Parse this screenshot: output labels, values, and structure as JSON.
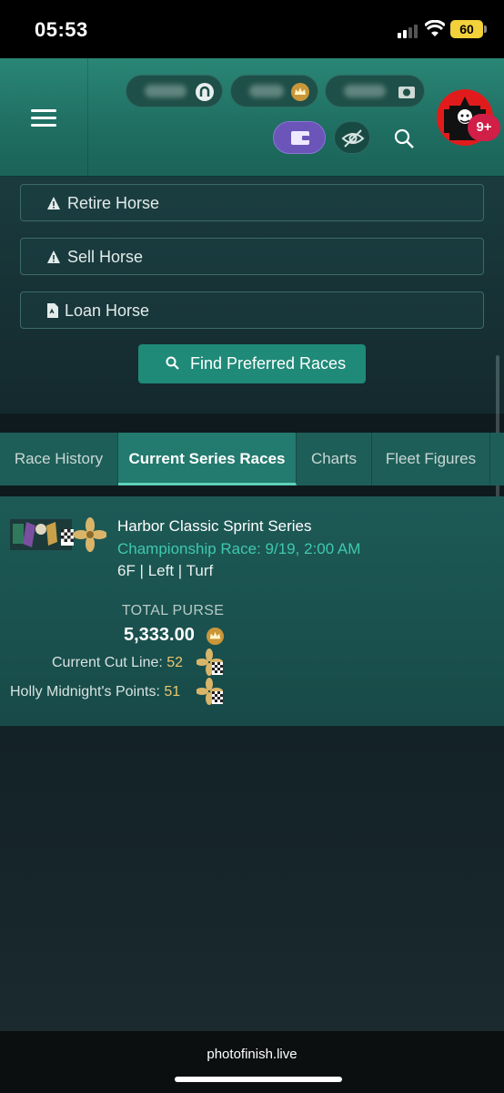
{
  "status_bar": {
    "time": "05:53",
    "battery": "60"
  },
  "header": {
    "menu_icon": "hamburger-icon",
    "currency_pills": [
      {
        "icon": "horseshoe-icon"
      },
      {
        "icon": "crown-coin-icon"
      },
      {
        "icon": "camera-icon"
      }
    ],
    "wallet_icon": "wallet-icon",
    "visibility_icon": "eye-off-icon",
    "search_icon": "search-icon",
    "notification_badge": "9+",
    "colors": {
      "header_bg": "#2a8676",
      "wallet_bg": "#6b55b8",
      "badge_bg": "#d11f47"
    }
  },
  "actions": {
    "retire": "Retire Horse",
    "sell": "Sell Horse",
    "loan": "Loan Horse",
    "find_races": "Find Preferred Races"
  },
  "tabs": [
    {
      "label": "Race History",
      "active": false
    },
    {
      "label": "Current Series Races",
      "active": true
    },
    {
      "label": "Charts",
      "active": false
    },
    {
      "label": "Fleet Figures",
      "active": false
    }
  ],
  "race": {
    "title": "Harbor Classic Sprint Series",
    "subtitle": "Championship Race: 9/19, 2:00 AM",
    "meta": "6F | Left | Turf",
    "purse_label": "TOTAL PURSE",
    "purse_value": "5,333.00",
    "cut_line_label": "Current Cut Line: ",
    "cut_line_value": "52",
    "points_label": "Holly Midnight's Points: ",
    "points_value": "51"
  },
  "footer": {
    "url": "photofinish.live"
  }
}
